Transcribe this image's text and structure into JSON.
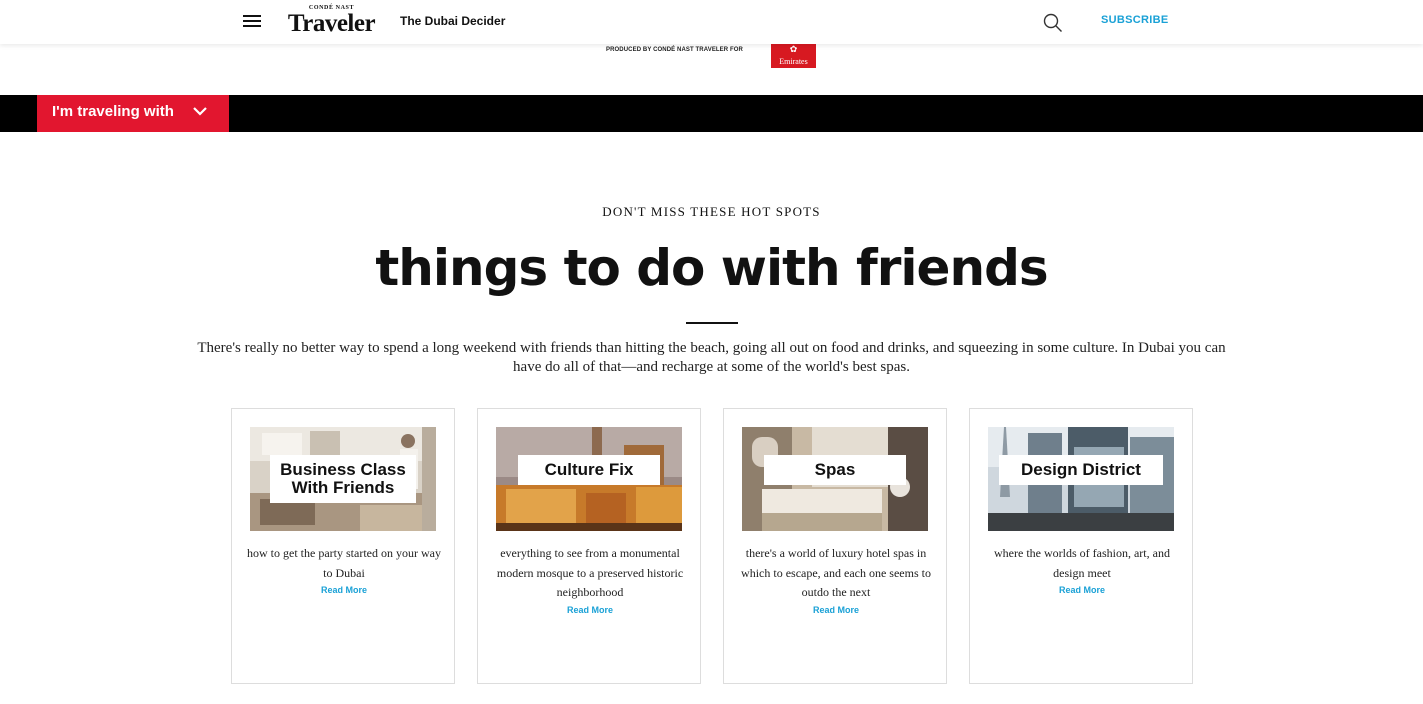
{
  "header": {
    "logo_top": "CONDÉ NAST",
    "logo_main": "Traveler",
    "section_title": "The Dubai Decider",
    "subscribe_label": "SUBSCRIBE"
  },
  "sponsor": {
    "text": "PRODUCED BY CONDÉ NAST TRAVELER FOR",
    "brand": "Emirates"
  },
  "traveling_dropdown": {
    "label": "I'm traveling with"
  },
  "intro": {
    "kicker": "DON'T MISS THESE HOT SPOTS",
    "headline": "things to do with friends",
    "body": "There's really no better way to spend a long weekend with friends than hitting the beach, going all out on food and drinks, and squeezing in some culture. In Dubai you can have do all of that—and recharge at some of the world's best spas."
  },
  "cards": [
    {
      "title_line1": "Business Class",
      "title_line2": "With Friends",
      "description": "how to get the party started on your way to Dubai",
      "link": "Read More"
    },
    {
      "title_line1": "Culture Fix",
      "description": "everything to see from a monumental modern mosque to a preserved historic neighborhood",
      "link": "Read More"
    },
    {
      "title_line1": "Spas",
      "description": "there's a world of luxury hotel spas in which to escape, and each one seems to outdo the next",
      "link": "Read More"
    },
    {
      "title_line1": "Design District",
      "description": "where the worlds of fashion, art, and design meet",
      "link": "Read More"
    }
  ],
  "colors": {
    "accent_red": "#e2162f",
    "link_blue": "#1aa1d6",
    "bar_black": "#000000"
  }
}
